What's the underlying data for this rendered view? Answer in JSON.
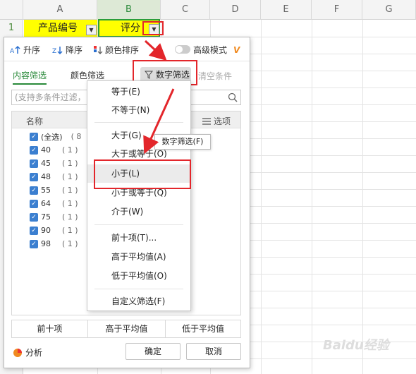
{
  "sheet": {
    "columns": [
      "A",
      "B",
      "C",
      "D",
      "E",
      "F",
      "G"
    ],
    "row_number": "1",
    "cell_a1": "产品编号",
    "cell_b1": "评分"
  },
  "filter_panel": {
    "toolbar": {
      "asc": "升序",
      "desc": "降序",
      "color_sort": "颜色排序",
      "advanced_mode": "高级模式"
    },
    "tabs": {
      "content": "内容筛选",
      "color": "颜色筛选",
      "number": "数字筛选",
      "clear": "清空条件"
    },
    "search_placeholder": "(支持多条件过滤，",
    "list_header": {
      "name": "名称",
      "options": "选项"
    },
    "items": [
      {
        "label": "(全选)",
        "count": "( 8"
      },
      {
        "label": "40",
        "count": "( 1 )"
      },
      {
        "label": "45",
        "count": "( 1 )"
      },
      {
        "label": "48",
        "count": "( 1 )"
      },
      {
        "label": "55",
        "count": "( 1 )"
      },
      {
        "label": "64",
        "count": "( 1 )"
      },
      {
        "label": "75",
        "count": "( 1 )"
      },
      {
        "label": "90",
        "count": "( 1 )"
      },
      {
        "label": "98",
        "count": "( 1 )"
      }
    ],
    "bottom_buttons": [
      "前十项",
      "高于平均值",
      "低于平均值"
    ],
    "analysis": "分析",
    "ok": "确定",
    "cancel": "取消"
  },
  "number_menu": {
    "items": [
      "等于(E)",
      "不等于(N)",
      "大于(G)",
      "大于或等于(O)",
      "小于(L)",
      "小于或等于(Q)",
      "介于(W)",
      "前十项(T)...",
      "高于平均值(A)",
      "低于平均值(O)",
      "自定义筛选(F)"
    ],
    "tooltip": "数字筛选(F)"
  },
  "watermark": "Baidu经验",
  "colors": {
    "highlight": "#ffff00",
    "accent_green": "#2a8a3a",
    "annotation_red": "#e3262b",
    "checkbox_blue": "#3b7fd0"
  }
}
